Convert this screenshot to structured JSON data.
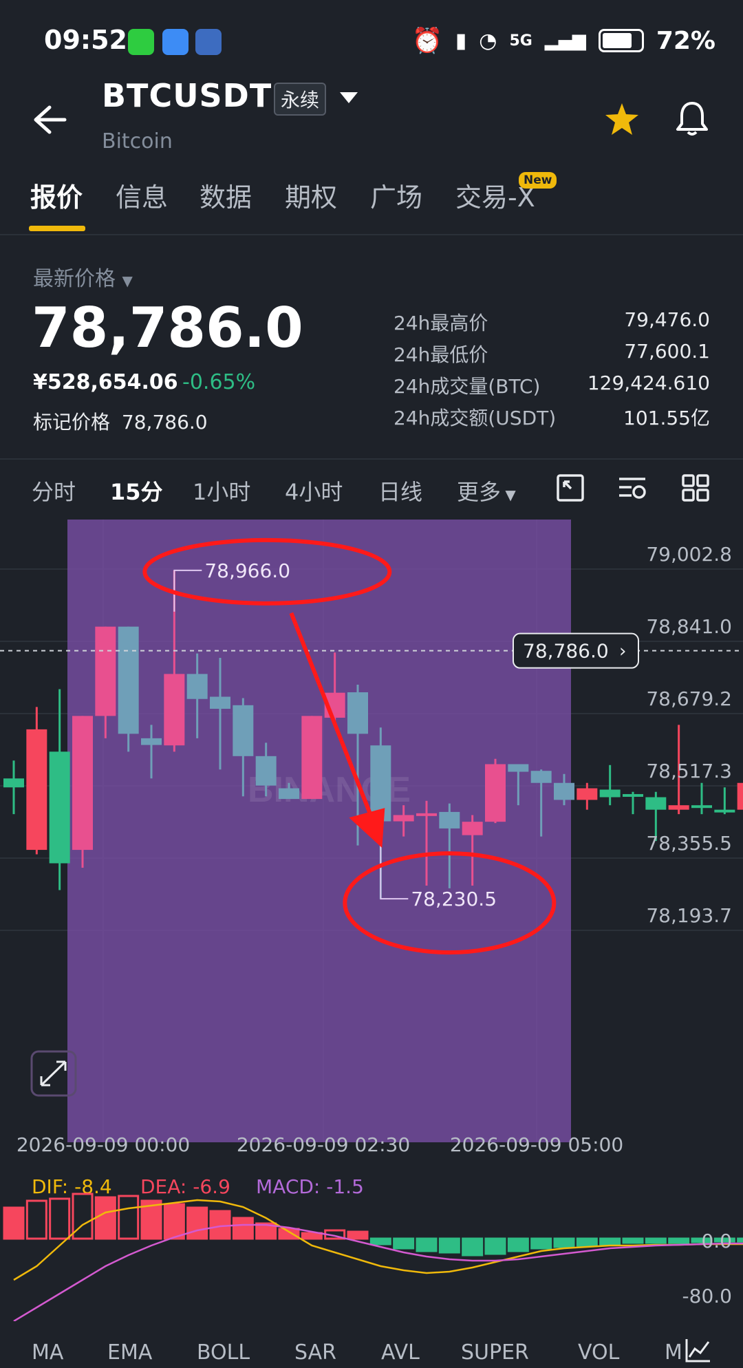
{
  "status_bar": {
    "time": "09:52",
    "network": "5G",
    "battery": "72%"
  },
  "header": {
    "symbol": "BTCUSDT",
    "contract_type": "永续",
    "subtitle": "Bitcoin",
    "favorite_color": "#f0b90b"
  },
  "tabs": [
    {
      "label": "报价",
      "active": true
    },
    {
      "label": "信息"
    },
    {
      "label": "数据"
    },
    {
      "label": "期权"
    },
    {
      "label": "广场"
    },
    {
      "label": "交易-X",
      "badge": "New"
    }
  ],
  "ticker": {
    "latest_label": "最新价格",
    "last_price": "78,786.0",
    "cny_price": "¥528,654.06",
    "change": "-0.65%",
    "mark_label": "标记价格",
    "mark_price": "78,786.0",
    "stats": [
      {
        "label": "24h最高价",
        "value": "79,476.0"
      },
      {
        "label": "24h最低价",
        "value": "77,600.1"
      },
      {
        "label": "24h成交量(BTC)",
        "value": "129,424.610"
      },
      {
        "label": "24h成交额(USDT)",
        "value": "101.55亿"
      }
    ]
  },
  "intervals": [
    {
      "label": "分时"
    },
    {
      "label": "15分",
      "active": true
    },
    {
      "label": "1小时"
    },
    {
      "label": "4小时"
    },
    {
      "label": "日线"
    },
    {
      "label": "更多"
    }
  ],
  "chart_data": {
    "type": "candlestick",
    "y_ticks": [
      "79,002.8",
      "78,841.0",
      "78,679.2",
      "78,517.3",
      "78,355.5",
      "78,193.7"
    ],
    "x_ticks": [
      "2026-09-09 00:00",
      "2026-09-09 02:30",
      "2026-09-09 05:00"
    ],
    "current_price_label": "78,786.0",
    "annotations": {
      "high_label": "78,966.0",
      "low_label": "78,230.5"
    },
    "watermark": "BINANCE",
    "colors": {
      "up": "#f6465d",
      "down": "#2ebd85",
      "highlight": "#7b4fa8",
      "annotation": "#ff1a1a"
    },
    "candles": [
      {
        "o": 78500,
        "h": 78540,
        "c": 78480,
        "l": 78420,
        "up": false
      },
      {
        "o": 78340,
        "h": 78660,
        "c": 78610,
        "l": 78330,
        "up": true
      },
      {
        "o": 78310,
        "h": 78700,
        "c": 78560,
        "l": 78250,
        "up": false
      },
      {
        "o": 78340,
        "h": 78640,
        "c": 78640,
        "l": 78300,
        "up": true
      },
      {
        "o": 78640,
        "h": 78840,
        "c": 78840,
        "l": 78590,
        "up": true
      },
      {
        "o": 78840,
        "h": 78840,
        "c": 78600,
        "l": 78560,
        "up": false
      },
      {
        "o": 78590,
        "h": 78620,
        "c": 78575,
        "l": 78500,
        "up": false
      },
      {
        "o": 78574,
        "h": 78966,
        "c": 78734,
        "l": 78560,
        "up": true
      },
      {
        "o": 78734,
        "h": 78780,
        "c": 78678,
        "l": 78590,
        "up": false
      },
      {
        "o": 78683,
        "h": 78770,
        "c": 78656,
        "l": 78520,
        "up": false
      },
      {
        "o": 78664,
        "h": 78680,
        "c": 78550,
        "l": 78460,
        "up": false
      },
      {
        "o": 78550,
        "h": 78580,
        "c": 78484,
        "l": 78460,
        "up": false
      },
      {
        "o": 78478,
        "h": 78490,
        "c": 78454,
        "l": 78460,
        "up": false
      },
      {
        "o": 78454,
        "h": 78640,
        "c": 78640,
        "l": 78454,
        "up": true
      },
      {
        "o": 78636,
        "h": 78782,
        "c": 78692,
        "l": 78630,
        "up": true
      },
      {
        "o": 78693,
        "h": 78710,
        "c": 78600,
        "l": 78350,
        "up": false
      },
      {
        "o": 78574,
        "h": 78614,
        "c": 78404,
        "l": 78230,
        "up": false
      },
      {
        "o": 78404,
        "h": 78440,
        "c": 78418,
        "l": 78370,
        "up": true
      },
      {
        "o": 78422,
        "h": 78450,
        "c": 78418,
        "l": 78260,
        "up": true
      },
      {
        "o": 78425,
        "h": 78444,
        "c": 78388,
        "l": 78254,
        "up": false
      },
      {
        "o": 78373,
        "h": 78418,
        "c": 78403,
        "l": 78260,
        "up": true
      },
      {
        "o": 78403,
        "h": 78544,
        "c": 78532,
        "l": 78400,
        "up": true
      },
      {
        "o": 78532,
        "h": 78530,
        "c": 78515,
        "l": 78440,
        "up": false
      },
      {
        "o": 78517,
        "h": 78520,
        "c": 78490,
        "l": 78370,
        "up": false
      },
      {
        "o": 78490,
        "h": 78510,
        "c": 78452,
        "l": 78440,
        "up": false
      },
      {
        "o": 78452,
        "h": 78490,
        "c": 78478,
        "l": 78430,
        "up": true
      },
      {
        "o": 78475,
        "h": 78530,
        "c": 78458,
        "l": 78440,
        "up": false
      },
      {
        "o": 78465,
        "h": 78470,
        "c": 78459,
        "l": 78420,
        "up": false
      },
      {
        "o": 78458,
        "h": 78470,
        "c": 78430,
        "l": 78360,
        "up": false
      },
      {
        "o": 78430,
        "h": 78620,
        "c": 78440,
        "l": 78420,
        "up": true
      },
      {
        "o": 78440,
        "h": 78490,
        "c": 78435,
        "l": 78420,
        "up": false
      },
      {
        "o": 78430,
        "h": 78480,
        "c": 78425,
        "l": 78420,
        "up": false
      },
      {
        "o": 78430,
        "h": 78500,
        "c": 78490,
        "l": 78420,
        "up": true
      }
    ]
  },
  "macd": {
    "dif_label": "DIF: -8.4",
    "dea_label": "DEA: -6.9",
    "macd_label": "MACD: -1.5",
    "y_ticks": [
      "0.0",
      "-80.0"
    ],
    "histogram": [
      45,
      55,
      58,
      65,
      60,
      62,
      55,
      50,
      45,
      40,
      30,
      22,
      14,
      8,
      12,
      10,
      -8,
      -14,
      -18,
      -20,
      -24,
      -22,
      -18,
      -14,
      -12,
      -10,
      -8,
      -6,
      -6,
      -6,
      -5,
      -4,
      -4
    ],
    "dif": [
      -60,
      -40,
      -10,
      20,
      38,
      44,
      48,
      52,
      56,
      54,
      46,
      30,
      10,
      -10,
      -20,
      -30,
      -40,
      -46,
      -50,
      -48,
      -42,
      -34,
      -26,
      -18,
      -14,
      -12,
      -10,
      -10,
      -9,
      -9,
      -8,
      -8,
      -8
    ],
    "dea": [
      -120,
      -100,
      -80,
      -60,
      -40,
      -24,
      -10,
      2,
      12,
      18,
      20,
      20,
      16,
      10,
      4,
      -4,
      -12,
      -20,
      -26,
      -30,
      -32,
      -32,
      -30,
      -26,
      -22,
      -18,
      -14,
      -12,
      -10,
      -9,
      -8,
      -7,
      -7
    ]
  },
  "bottom_indicators": [
    "MA",
    "EMA",
    "BOLL",
    "SAR",
    "AVL",
    "SUPER",
    "VOL",
    "M"
  ]
}
